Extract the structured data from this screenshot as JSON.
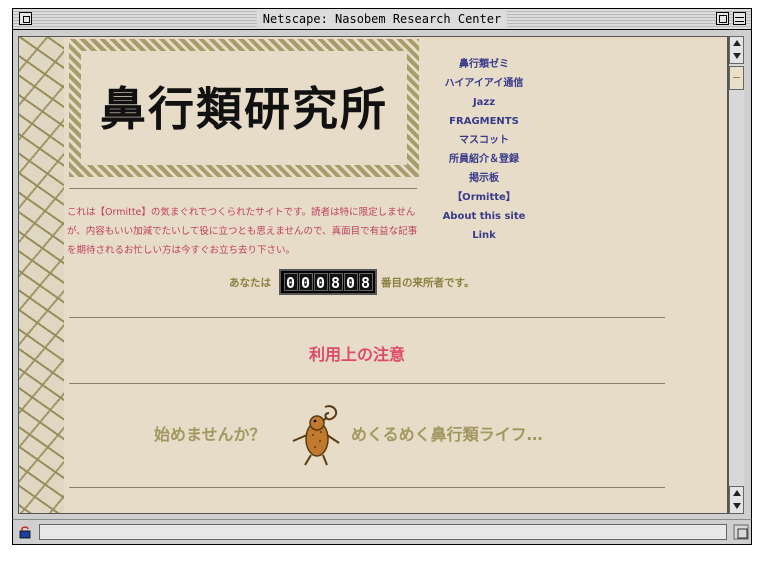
{
  "window": {
    "title": "Netscape: Nasobem Research Center"
  },
  "header": {
    "logo_text": "鼻行類研究所"
  },
  "nav": {
    "items": [
      {
        "label": "鼻行類ゼミ"
      },
      {
        "label": "ハイアイアイ通信"
      },
      {
        "label": "Jazz"
      },
      {
        "label": "FRAGMENTS"
      },
      {
        "label": "マスコット"
      },
      {
        "label": "所員紹介＆登録"
      },
      {
        "label": "掲示板"
      },
      {
        "label": "【Ormitte】"
      },
      {
        "label": "About this site"
      },
      {
        "label": "Link"
      }
    ]
  },
  "intro": {
    "text": "これは【Ormitte】の気まぐれでつくられたサイトです。読者は特に限定しませんが、内容もいい加減でたいして役に立つとも思えませんので、真面目で有益な記事を期待されるお忙しい方は今すぐお立ち去り下さい。"
  },
  "counter": {
    "prefix": "あなたは",
    "digits": [
      "0",
      "0",
      "0",
      "8",
      "0",
      "8"
    ],
    "suffix": "番目の来所者です。"
  },
  "notice": {
    "label": "利用上の注意"
  },
  "slogan": {
    "left": "始めませんか？",
    "right": "めくるめく鼻行類ライフ…"
  },
  "colors": {
    "background": "#e6dcc7",
    "nav_link": "#3a3a8c",
    "intro_text": "#c04060",
    "notice": "#e04a6a",
    "slogan": "#a19760"
  }
}
